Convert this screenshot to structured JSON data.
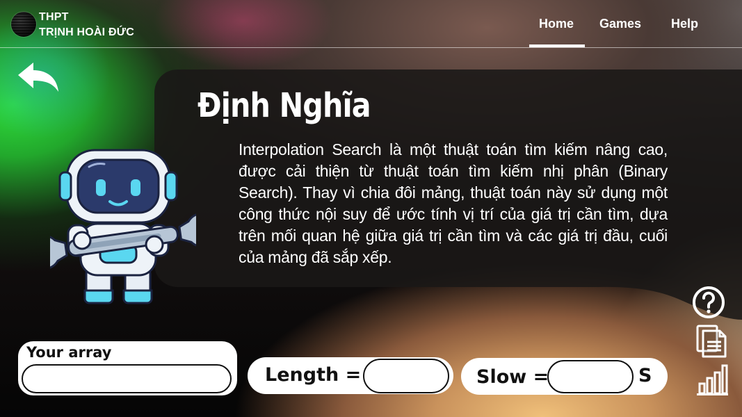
{
  "school": {
    "line1": "THPT",
    "line2": "TRỊNH HOÀI ĐỨC"
  },
  "nav": {
    "home": "Home",
    "games": "Games",
    "help": "Help"
  },
  "definition": {
    "title": "Định Nghĩa",
    "body": "Interpolation Search là một thuật toán tìm kiếm nâng cao, được cải thiện từ thuật toán tìm kiếm nhị phân (Binary Search). Thay vì chia đôi mảng, thuật toán này sử dụng một công thức nội suy để ước tính vị trí của giá trị cần tìm, dựa trên mối quan hệ giữa giá trị cần tìm và các giá trị đầu, cuối của mảng đã sắp xếp."
  },
  "controls": {
    "array_label": "Your array",
    "array_value": "",
    "length_label": "Length =",
    "length_value": "",
    "slow_label": "Slow =",
    "slow_value": "",
    "slow_unit": "S"
  },
  "icons": {
    "back": "back-arrow-icon",
    "help": "help-circle-icon",
    "documents": "documents-icon",
    "chart": "bar-chart-icon"
  },
  "colors": {
    "robot_accent": "#5ad7f0",
    "robot_visor": "#2b3a6b",
    "panel": "#1c1a19"
  }
}
